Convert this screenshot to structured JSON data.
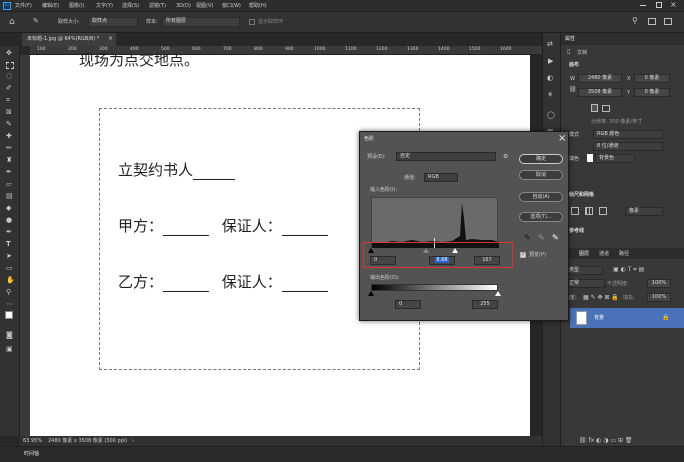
{
  "menu": [
    "文件(F)",
    "编辑(E)",
    "图像(I)",
    "文字(Y)",
    "选择(S)",
    "滤镜(T)",
    "3D(D)",
    "视图(V)",
    "窗口(W)",
    "帮助(H)"
  ],
  "options": {
    "sample_label": "取样大小:",
    "sample_value": "取样点",
    "sample2_label": "样本:",
    "sample2_value": "所有图层",
    "ring_label": "显示取样环"
  },
  "doc_tab": "未标题-1.jpg @ 64%(RGB/8) *",
  "ruler_marks": [
    "100",
    "200",
    "300",
    "400",
    "500",
    "600",
    "700",
    "800",
    "900",
    "1000",
    "1100",
    "1200",
    "1300",
    "1400",
    "1500",
    "1600"
  ],
  "document": {
    "top_line": "现场为点交地点。",
    "line1_prefix": "立契约书人",
    "line2_a": "甲方：",
    "line2_b": "保证人：",
    "line3_a": "乙方：",
    "line3_b": "保证人："
  },
  "status": {
    "zoom": "63.95%",
    "size": "2480 像素 x 3508 像素 (300 ppi)"
  },
  "timeline_label": "时间轴",
  "levels": {
    "title": "色阶",
    "preset_label": "预设(E):",
    "preset_value": "自定",
    "channel_label": "通道:",
    "channel_value": "RGB",
    "input_label": "输入色阶(I):",
    "input_black": "0",
    "input_gamma": "8.68",
    "input_white": "167",
    "output_label": "输出色阶(O):",
    "output_black": "0",
    "output_white": "255",
    "ok": "确定",
    "cancel": "取消",
    "auto": "自动(A)",
    "options": "选项(T)...",
    "preview": "预览(P)"
  },
  "properties": {
    "tab": "属性",
    "doc_label": "文档",
    "canvas_label": "画布",
    "w_label": "W",
    "w_value": "2480 像素",
    "x_label": "X",
    "x_value": "0 像素",
    "h_label": "H",
    "h_value": "3508 像素",
    "y_label": "Y",
    "y_value": "0 像素",
    "resolution": "分辨率: 300 像素/英寸",
    "mode_label": "模式",
    "mode_value": "RGB 颜色",
    "depth_value": "8 位/通道",
    "bg_label": "填色",
    "bg_value": "背景色",
    "rulers_title": "标尺和网格",
    "rulers_unit": "像素",
    "guides_title": "参考线"
  },
  "layers": {
    "tabs": [
      "图层",
      "通道",
      "路径"
    ],
    "kind": "类型",
    "mode": "正常",
    "opacity_label": "不透明度:",
    "opacity_value": "100%",
    "lock_label": "锁定:",
    "fill_label": "填充:",
    "fill_value": "100%",
    "layer_name": "背景"
  },
  "colors": {
    "highlight_box": "#e03030",
    "selected_layer": "#4a72b8",
    "accent": "#2b63c6"
  }
}
